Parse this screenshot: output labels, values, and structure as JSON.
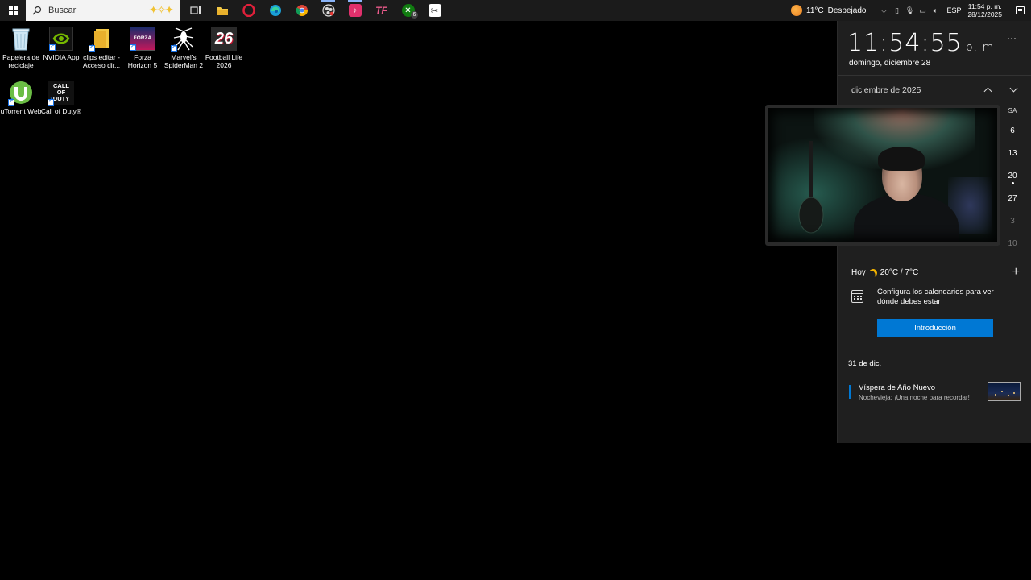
{
  "taskbar": {
    "search_placeholder": "Buscar",
    "apps": [
      {
        "name": "task-view",
        "active": false
      },
      {
        "name": "file-explorer",
        "active": false
      },
      {
        "name": "opera",
        "active": false
      },
      {
        "name": "edge",
        "active": false
      },
      {
        "name": "chrome",
        "active": false
      },
      {
        "name": "obs",
        "active": true
      },
      {
        "name": "tiktok",
        "active": true
      },
      {
        "name": "tf",
        "active": false
      },
      {
        "name": "xbox",
        "active": false,
        "badge": "6"
      },
      {
        "name": "capcut",
        "active": false
      }
    ],
    "weather": {
      "temp": "11°C",
      "condition": "Despejado",
      "badge": "1"
    },
    "language": "ESP",
    "clock_time": "11:54 p. m.",
    "clock_date": "28/12/2025",
    "app_labels": {
      "tf": "TF",
      "xbox_badge": "6"
    }
  },
  "desktop": {
    "icons": [
      {
        "label": "Papelera de reciclaje"
      },
      {
        "label": "NVIDIA App"
      },
      {
        "label": "clips editar - Acceso dir..."
      },
      {
        "label": "Forza Horizon 5"
      },
      {
        "label": "Marvel's SpiderMan 2"
      },
      {
        "label": "Football Life 2026"
      },
      {
        "label": "uTorrent Web"
      },
      {
        "label": "Call of Duty®"
      }
    ],
    "icon_text": {
      "forza": "FORZA",
      "fl26": "26",
      "cod": "CALL OF DUTY"
    }
  },
  "flyout": {
    "time": "11:54:55",
    "ampm": "p. m.",
    "more": "···",
    "date": "domingo, diciembre 28",
    "month": "diciembre de 2025",
    "col_sa": "SA",
    "saturdays": [
      "6",
      "13",
      "20",
      "27",
      "3",
      "10"
    ],
    "today_label": "Hoy",
    "today_weather": "20°C / 7°C",
    "add_event": "+",
    "config_text": "Configura los calendarios para ver dónde debes estar",
    "intro_button": "Introducción",
    "event_date": "31 de dic.",
    "event_title": "Víspera de Año Nuevo",
    "event_subtitle": "Nochevieja: ¡Una noche para recordar!"
  },
  "colors": {
    "accent": "#0078d4",
    "taskbar": "#1b1b1b",
    "flyout": "#1f1f1f"
  }
}
